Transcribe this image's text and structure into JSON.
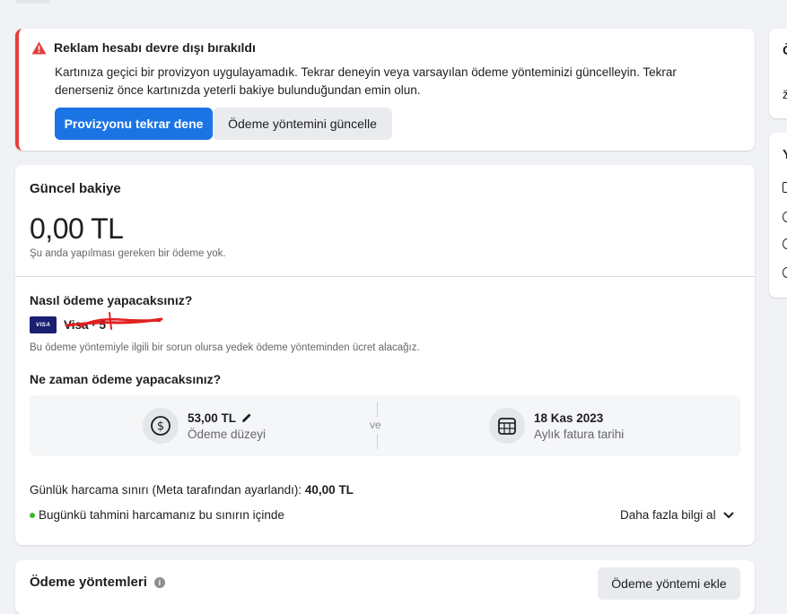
{
  "alert": {
    "title": "Reklam hesabı devre dışı bırakıldı",
    "body": "Kartınıza geçici bir provizyon uygulayamadık. Tekrar deneyin veya varsayılan ödeme yönteminizi güncelleyin. Tekrar denerseniz önce kartınızda yeterli bakiye bulunduğundan emin olun.",
    "primary_button": "Provizyonu tekrar dene",
    "secondary_button": "Ödeme yöntemini güncelle"
  },
  "balance": {
    "title": "Güncel bakiye",
    "amount": "0,00 TL",
    "amount_note": "Şu anda yapılması gereken bir ödeme yok.",
    "how_title": "Nasıl ödeme yapacaksınız?",
    "card_badge": "VISA",
    "card_name": "Visa · 5",
    "fallback_note": "Bu ödeme yöntemiyle ilgili bir sorun olursa yedek ödeme yönteminden ücret alacağız.",
    "when_title": "Ne zaman ödeme yapacaksınız?",
    "threshold_value": "53,00 TL",
    "threshold_label": "Ödeme düzeyi",
    "connector": "ve",
    "bill_date_value": "18 Kas 2023",
    "bill_date_label": "Aylık fatura tarihi",
    "daily_limit_label": "Günlük harcama sınırı (Meta tarafından ayarlandı): ",
    "daily_limit_value": "40,00 TL",
    "status_text": "Bugünkü tahmini harcamanız bu sınırın içinde",
    "more_link": "Daha fazla bilgi al"
  },
  "methods": {
    "title": "Ödeme yöntemleri",
    "info_glyph": "i",
    "add_button": "Ödeme yöntemi ekle"
  },
  "right_panel": {
    "card1_initial": "Ö",
    "card1_sub": "ž",
    "card2_initial": "Y"
  },
  "colors": {
    "accent": "#1b74e4",
    "alert_red": "#e4403b",
    "status_green": "#42b72a",
    "visa_blue": "#1a1f71"
  },
  "icons": [
    "warning-icon",
    "dollar-coin-icon",
    "pencil-icon",
    "calendar-icon",
    "chevron-down-icon",
    "info-icon"
  ]
}
